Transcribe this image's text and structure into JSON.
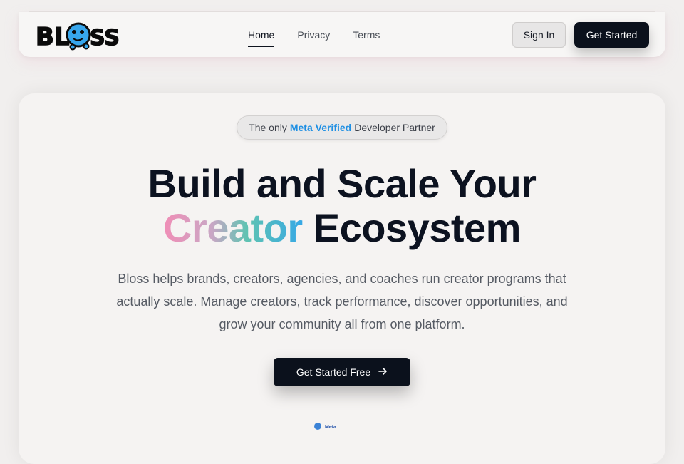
{
  "brand": {
    "logo_text": "BLOSS"
  },
  "nav": {
    "links": [
      {
        "label": "Home",
        "active": true
      },
      {
        "label": "Privacy",
        "active": false
      },
      {
        "label": "Terms",
        "active": false
      }
    ],
    "sign_in": "Sign In",
    "get_started": "Get Started"
  },
  "hero": {
    "badge": {
      "prefix": "The only",
      "highlight": "Meta Verified",
      "suffix": "Developer Partner"
    },
    "headline": {
      "line1": "Build and Scale Your",
      "gradient_word": "Creator",
      "line2_rest": "Ecosystem"
    },
    "subtitle": "Bloss helps brands, creators, agencies, and coaches run creator programs that actually scale. Manage creators, track performance, discover opportunities, and grow your community all from one platform.",
    "cta_label": "Get Started Free",
    "partner_mark": "Meta"
  },
  "colors": {
    "accent_blue": "#1e8fe3",
    "dark_button": "#0b111c",
    "gradient": [
      "#f08db6",
      "#5fc3b2",
      "#36a8e6"
    ]
  },
  "icons": {
    "cta": "arrow-right-icon",
    "partner": "meta-verified-icon"
  }
}
